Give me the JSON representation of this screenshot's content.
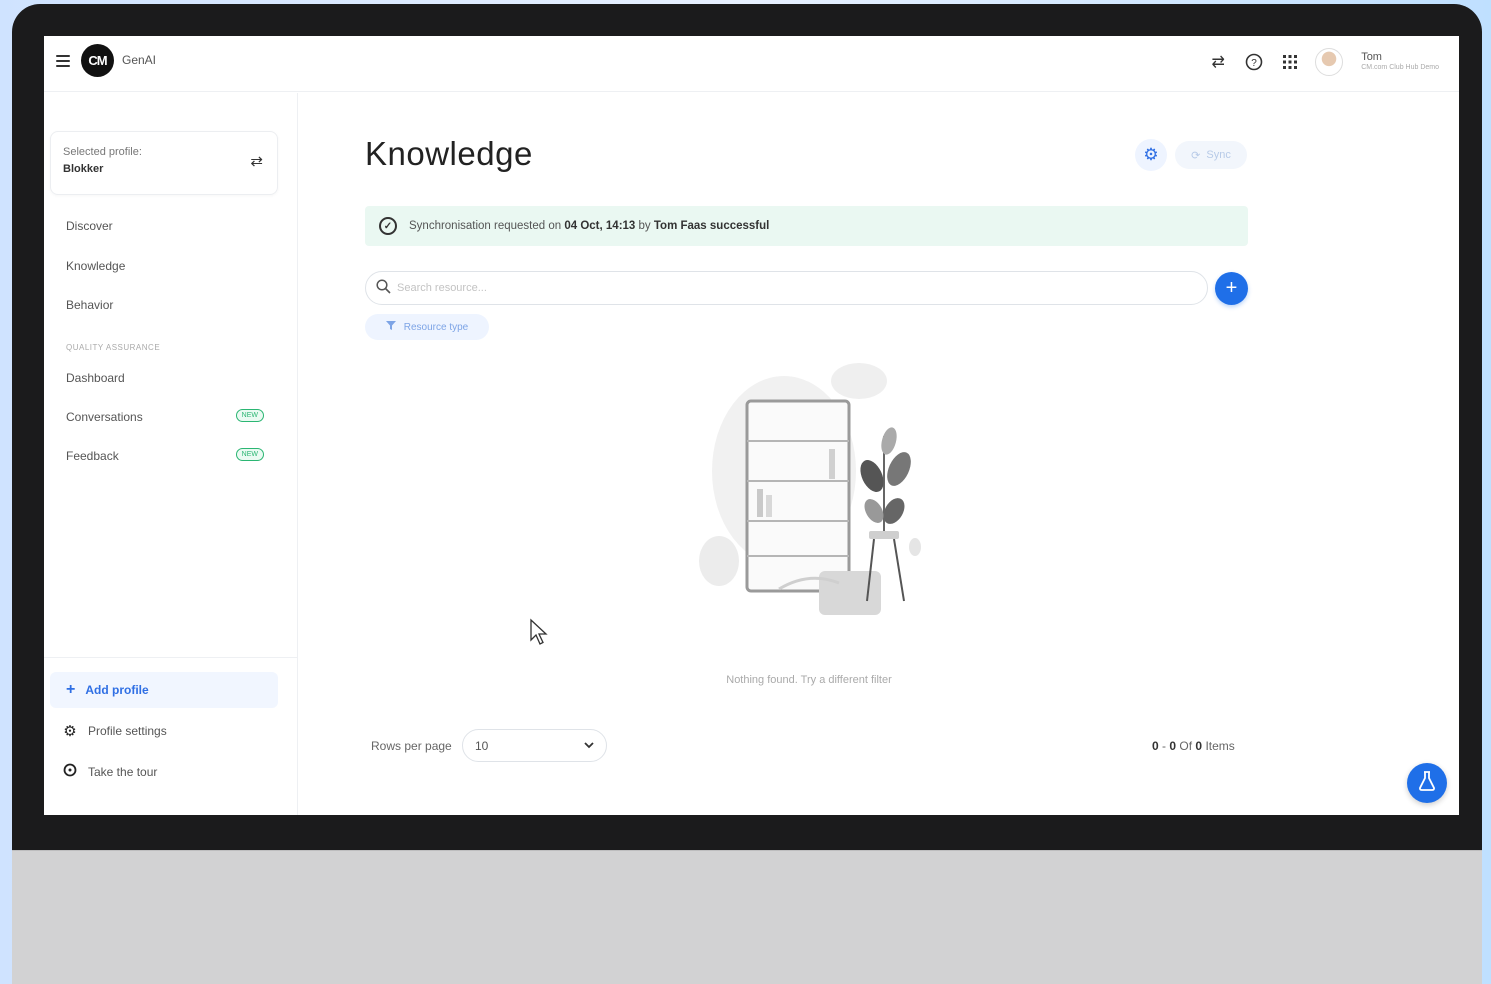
{
  "app": {
    "brand_logo": "CM",
    "app_name": "GenAI"
  },
  "header": {
    "icons": [
      "swap-icon",
      "help-icon",
      "apps-grid-icon"
    ],
    "user_name": "Tom",
    "user_subtitle": "CM.com Club Hub Demo"
  },
  "sidebar": {
    "profile_label": "Selected profile:",
    "profile_value": "Blokker",
    "items": [
      {
        "label": "Discover"
      },
      {
        "label": "Knowledge"
      },
      {
        "label": "Behavior"
      }
    ],
    "section_title": "QUALITY ASSURANCE",
    "qa_items": [
      {
        "label": "Dashboard",
        "badge": ""
      },
      {
        "label": "Conversations",
        "badge": "NEW"
      },
      {
        "label": "Feedback",
        "badge": "NEW"
      }
    ],
    "add_profile": "Add profile",
    "profile_settings": "Profile settings",
    "take_tour": "Take the tour"
  },
  "main": {
    "title": "Knowledge",
    "sync_label": "Sync",
    "alert": {
      "prefix": "Synchronisation requested on ",
      "date": "04 Oct, 14:13",
      "middle": " by ",
      "user": "Tom Faas",
      "suffix": "successful"
    },
    "search_placeholder": "Search resource...",
    "filter_label": "Resource type",
    "empty_text": "Nothing found. Try a different filter",
    "rows_per_page_label": "Rows per page",
    "rows_per_page_value": "10",
    "pagination": {
      "start": "0",
      "end": "0",
      "of": "Of",
      "total": "0",
      "unit": "Items"
    }
  },
  "colors": {
    "accent": "#1f6fe8",
    "success_bg": "#eaf8f2",
    "badge": "#2bb673"
  }
}
